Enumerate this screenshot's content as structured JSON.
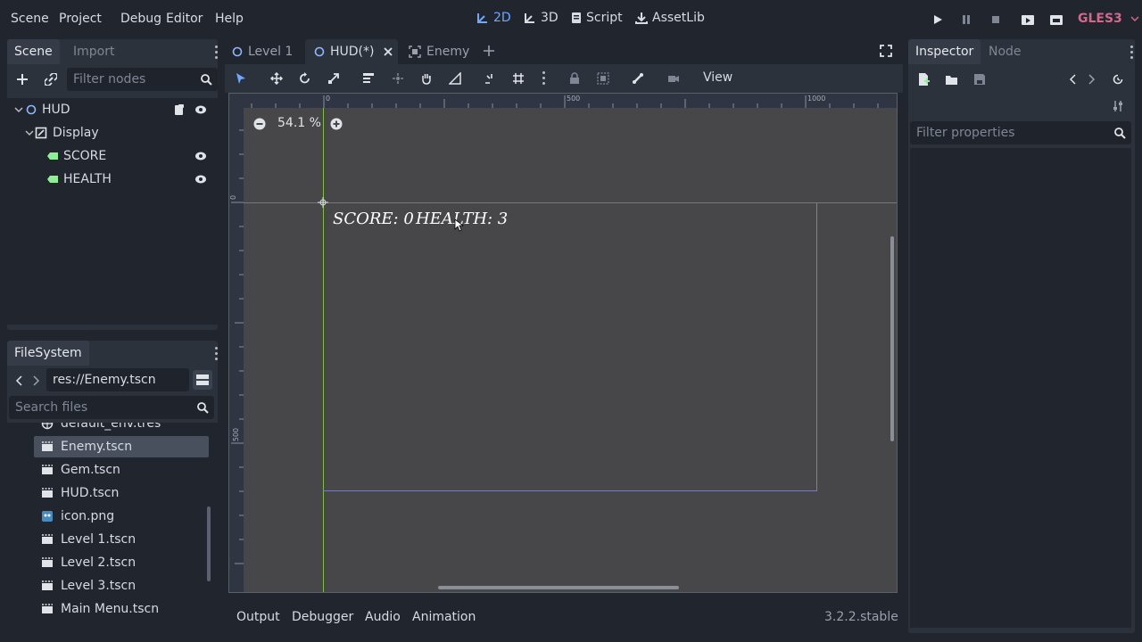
{
  "menubar": {
    "menus": [
      "Scene",
      "Project",
      "Debug",
      "Editor",
      "Help"
    ],
    "modes": {
      "two_d": "2D",
      "three_d": "3D",
      "script": "Script",
      "assetlib": "AssetLib"
    },
    "renderer": "GLES3",
    "icons": [
      "play-icon",
      "pause-icon",
      "stop-icon",
      "play-scene-icon",
      "play-custom-icon"
    ]
  },
  "scene_panel": {
    "tabs": {
      "scene": "Scene",
      "import": "Import"
    },
    "filter_placeholder": "Filter nodes",
    "nodes": [
      {
        "label": "HUD",
        "icon": "control-node-icon"
      },
      {
        "label": "Display",
        "icon": "container-icon"
      },
      {
        "label": "SCORE",
        "icon": "label-node-icon"
      },
      {
        "label": "HEALTH",
        "icon": "label-node-icon"
      }
    ]
  },
  "filesystem": {
    "title": "FileSystem",
    "path": "res://Enemy.tscn",
    "search_placeholder": "Search files",
    "files": [
      {
        "name": "default_env.tres",
        "icon": "resource-icon"
      },
      {
        "name": "Enemy.tscn",
        "icon": "scene-icon",
        "selected": true
      },
      {
        "name": "Gem.tscn",
        "icon": "scene-icon"
      },
      {
        "name": "HUD.tscn",
        "icon": "scene-icon"
      },
      {
        "name": "icon.png",
        "icon": "image-icon"
      },
      {
        "name": "Level 1.tscn",
        "icon": "scene-icon"
      },
      {
        "name": "Level 2.tscn",
        "icon": "scene-icon"
      },
      {
        "name": "Level 3.tscn",
        "icon": "scene-icon"
      },
      {
        "name": "Main Menu.tscn",
        "icon": "scene-icon"
      }
    ]
  },
  "editor": {
    "tabs": [
      {
        "label": "Level 1",
        "icon": "control-node-icon"
      },
      {
        "label": "HUD(*)",
        "icon": "control-node-icon",
        "active": true
      },
      {
        "label": "Enemy",
        "icon": "container-icon"
      }
    ],
    "view_menu": "View",
    "zoom": "54.1 %",
    "ruler_h": [
      "0",
      "500",
      "1000"
    ],
    "ruler_v": [
      "0",
      "500"
    ],
    "canvas_text": {
      "score": "SCORE: 0",
      "health": "HEALTH: 3"
    }
  },
  "inspector": {
    "tabs": {
      "inspector": "Inspector",
      "node": "Node"
    },
    "filter_placeholder": "Filter properties"
  },
  "bottom_panel": {
    "tabs": [
      "Output",
      "Debugger",
      "Audio",
      "Animation"
    ],
    "version": "3.2.2.stable"
  },
  "colors": {
    "accent": "#6ea8ff",
    "renderer": "#d7668a",
    "label_node": "#8eef97",
    "viewport": "#47474a"
  }
}
